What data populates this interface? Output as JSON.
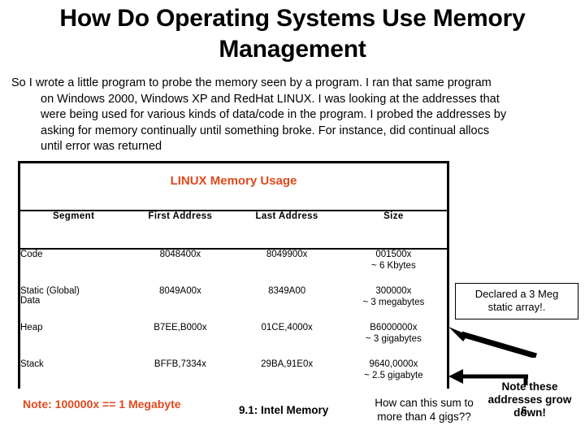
{
  "slide": {
    "title": "How Do Operating Systems Use Memory Management",
    "page_number": "6",
    "footer_label": "9.1: Intel Memory"
  },
  "body": {
    "line1": "So I wrote a little program to probe the memory seen by a program.  I ran that same program",
    "line2": "on Windows 2000, Windows XP and RedHat LINUX.  I was looking at the addresses that",
    "line3": "were being used for various kinds of data/code in the program.  I probed the addresses by",
    "line4": "asking for memory continually until something broke.  For instance, did continual allocs",
    "line5": "until error was returned"
  },
  "table": {
    "title": "LINUX Memory Usage",
    "title_color": "#E0481E",
    "columns": [
      "Segment",
      "First Address",
      "Last Address",
      "Size"
    ],
    "rows": [
      {
        "segment": "Code",
        "segment_line2": "",
        "first_address": "8048400x",
        "last_address": "8049900x",
        "size": "001500x",
        "size_approx": "~ 6 Kbytes"
      },
      {
        "segment": "Static (Global)",
        "segment_line2": "Data",
        "first_address": "8049A00x",
        "last_address": "8349A00",
        "size": "300000x",
        "size_approx": "~ 3 megabytes"
      },
      {
        "segment": "Heap",
        "segment_line2": "",
        "first_address": "B7EE,B000x",
        "last_address": "01CE,4000x",
        "size": "B6000000x",
        "size_approx": "~ 3 gigabytes"
      },
      {
        "segment": "Stack",
        "segment_line2": "",
        "first_address": "BFFB,7334x",
        "last_address": "29BA,91E0x",
        "size": "9640,0000x",
        "size_approx": "~ 2.5 gigabyte"
      }
    ]
  },
  "annotations": {
    "callout_line1": "Declared a 3 Meg",
    "callout_line2": "static array!.",
    "grow_down_line1": "Note these",
    "grow_down_line2": "addresses grow",
    "grow_down_line3": "down!",
    "megabyte_note": "Note:  100000x == 1 Megabyte",
    "megabyte_note_color": "#E0481E",
    "sum_question_line1": "How can this sum to",
    "sum_question_line2": "more than 4 gigs??"
  }
}
